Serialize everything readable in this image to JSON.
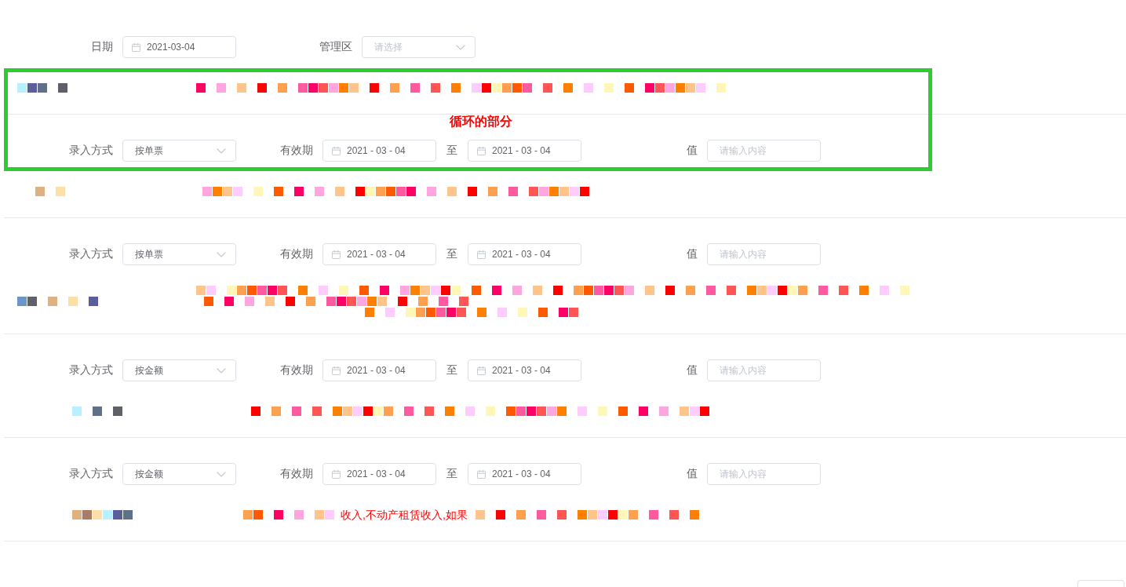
{
  "filters": [
    {
      "label": "日期",
      "kind": "date",
      "value": "2021-03-04"
    },
    {
      "label": "管理区",
      "kind": "select",
      "placeholder": "请选择"
    }
  ],
  "sections": [
    {
      "label": {
        "kind": "redacted"
      },
      "description": {
        "kind": "redacted"
      },
      "highlight": {
        "label": "循环的部分"
      },
      "entry": {
        "fields": [
          {
            "label": "录入方式",
            "kind": "select",
            "value": "按单票"
          },
          {
            "label": "有效期",
            "kind": "date_range",
            "from": "2021 - 03 - 04",
            "separator": "至",
            "to": "2021 - 03 - 04"
          },
          {
            "label": "值",
            "kind": "input",
            "placeholder": "请输入内容"
          }
        ]
      }
    },
    {
      "label": {
        "kind": "redacted"
      },
      "description": {
        "kind": "redacted"
      },
      "entry": {
        "fields": [
          {
            "label": "录入方式",
            "kind": "select",
            "value": "按单票"
          },
          {
            "label": "有效期",
            "kind": "date_range",
            "from": "2021 - 03 - 04",
            "separator": "至",
            "to": "2021 - 03 - 04"
          },
          {
            "label": "值",
            "kind": "input",
            "placeholder": "请输入内容"
          }
        ]
      }
    },
    {
      "label": {
        "kind": "redacted"
      },
      "description": {
        "kind": "redacted"
      },
      "entry": {
        "fields": [
          {
            "label": "录入方式",
            "kind": "select",
            "value": "按金额"
          },
          {
            "label": "有效期",
            "kind": "date_range",
            "from": "2021 - 03 - 04",
            "separator": "至",
            "to": "2021 - 03 - 04"
          },
          {
            "label": "值",
            "kind": "input",
            "placeholder": "请输入内容"
          }
        ]
      }
    },
    {
      "label": {
        "kind": "redacted"
      },
      "description": {
        "kind": "redacted"
      },
      "entry": {
        "fields": [
          {
            "label": "录入方式",
            "kind": "select",
            "value": "按金额"
          },
          {
            "label": "有效期",
            "kind": "date_range",
            "from": "2021 - 03 - 04",
            "separator": "至",
            "to": "2021 - 03 - 04"
          },
          {
            "label": "值",
            "kind": "input",
            "placeholder": "请输入内容"
          }
        ]
      }
    },
    {
      "label": {
        "kind": "redacted"
      },
      "description": {
        "kind": "partly_redacted",
        "visible_text": "收入,不动产租赁收入,如果"
      }
    }
  ],
  "footer": {
    "buttons": [
      {
        "kind": "plain"
      }
    ]
  }
}
